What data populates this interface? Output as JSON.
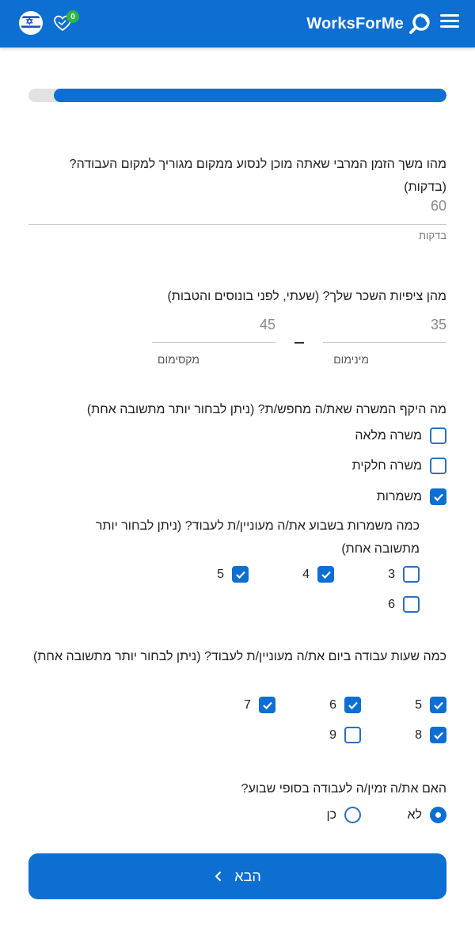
{
  "header": {
    "brand": "WorksForMe",
    "favorites_count": "0",
    "icons": {
      "menu": "hamburger-menu-icon",
      "logo": "search-logo-icon",
      "favorites": "heart-handshake-icon",
      "language": "israel-flag-icon"
    },
    "colors": {
      "primary": "#0d6fd1",
      "badge": "#2fb344"
    }
  },
  "progress": {
    "fraction": 0.94
  },
  "commute": {
    "question": "מהו משך הזמן המרבי שאתה מוכן לנסוע ממקום מגוריך למקום העבודה? (בדקות)",
    "value": "60",
    "unit": "בדקות"
  },
  "salary": {
    "question": "מהן ציפיות השכר שלך? (שעתי, לפני בונוסים והטבות)",
    "min_value": "35",
    "min_label": "מינימום",
    "max_value": "45",
    "max_label": "מקסימום"
  },
  "scope": {
    "question": "מה היקף המשרה שאת/ה מחפש/ת? (ניתן לבחור יותר מתשובה אחת)",
    "options": [
      {
        "label": "משרה מלאה",
        "checked": false
      },
      {
        "label": "משרה חלקית",
        "checked": false
      },
      {
        "label": "משמרות",
        "checked": true
      }
    ]
  },
  "shifts": {
    "question": "כמה משמרות בשבוע את/ה מעוניין/ת לעבוד? (ניתן לבחור יותר מתשובה אחת)",
    "options": [
      {
        "label": "3",
        "checked": false
      },
      {
        "label": "4",
        "checked": true
      },
      {
        "label": "5",
        "checked": true
      },
      {
        "label": "6",
        "checked": false
      }
    ]
  },
  "hours": {
    "question": "כמה שעות עבודה ביום את/ה מעוניין/ת לעבוד? (ניתן לבחור יותר מתשובה אחת)",
    "options": [
      {
        "label": "5",
        "checked": true
      },
      {
        "label": "6",
        "checked": true
      },
      {
        "label": "7",
        "checked": true
      },
      {
        "label": "8",
        "checked": true
      },
      {
        "label": "9",
        "checked": false
      }
    ]
  },
  "weekend": {
    "question": "האם את/ה זמין/ה לעבודה בסופי שבוע?",
    "options": [
      {
        "label": "לא",
        "checked": true
      },
      {
        "label": "כן",
        "checked": false
      }
    ]
  },
  "next_button": {
    "label": "הבא",
    "icon": "chevron-left-icon"
  }
}
